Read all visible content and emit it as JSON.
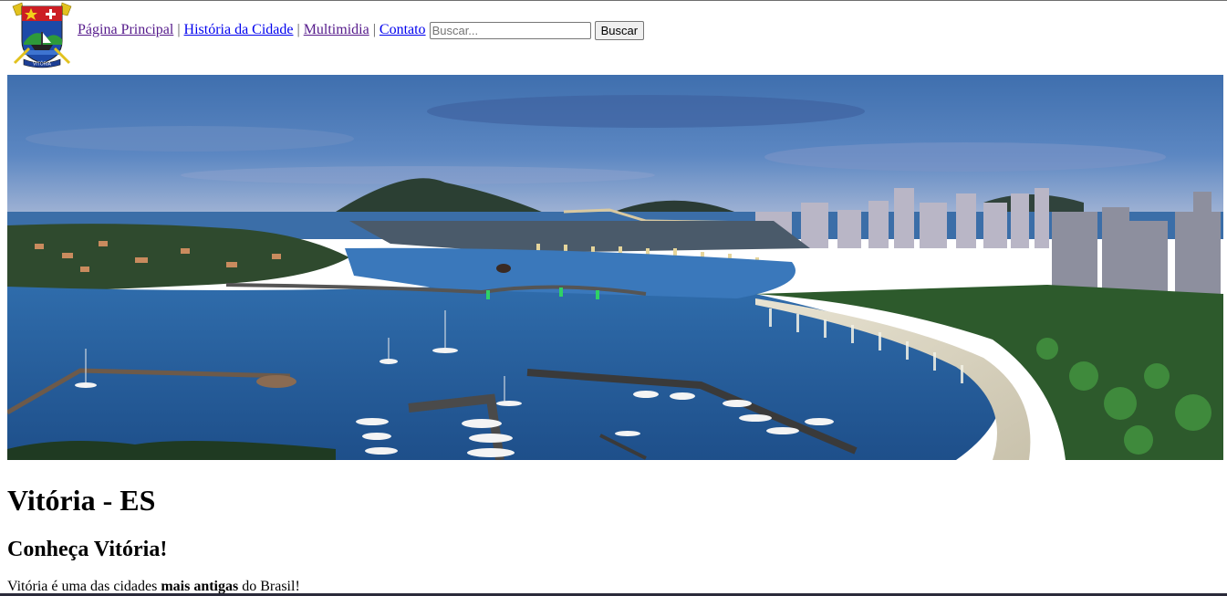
{
  "header": {
    "logo_alt": "Brasão de Vitória",
    "logo_ribbon_text": "VITÓRIA",
    "nav": [
      {
        "label": "Página Principal"
      },
      {
        "label": "História da Cidade"
      },
      {
        "label": "Multimidia"
      },
      {
        "label": "Contato"
      }
    ],
    "separator": "|",
    "search": {
      "placeholder": "Buscar...",
      "value": ""
    },
    "search_button_label": "Buscar"
  },
  "banner": {
    "description": "Vista panorâmica da baía de Vitória ao anoitecer"
  },
  "main": {
    "title": "Vitória - ES",
    "subtitle": "Conheça Vitória!",
    "intro_before": "Vitória é uma das cidades ",
    "intro_bold": "mais antigas",
    "intro_after": " do Brasil!"
  },
  "colors": {
    "link": "#0000ee",
    "link_visited": "#551a8b",
    "sky_top": "#4a78b6",
    "water": "#2b6fb5"
  }
}
